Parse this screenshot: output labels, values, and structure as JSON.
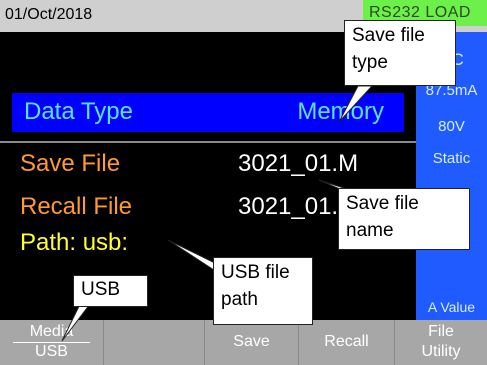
{
  "status_bar": {
    "date": "01/Oct/2018",
    "mode": "RS232 LOAD"
  },
  "data_type": {
    "label": "Data Type",
    "value": "Memory"
  },
  "save_file": {
    "label": "Save File",
    "value": "3021_01.M"
  },
  "recall_file": {
    "label": "Recall File",
    "value": "3021_01.M"
  },
  "path": {
    "label": "Path: usb:"
  },
  "sidebar": {
    "items": [
      "CC",
      "87.5mA",
      "80V",
      "Static",
      "A Value"
    ]
  },
  "softkeys": {
    "media_top": "Media",
    "media_bottom": "USB",
    "save": "Save",
    "recall": "Recall",
    "file_utility_top": "File",
    "file_utility_bottom": "Utility"
  },
  "callouts": {
    "save_file_type_1": "Save file",
    "save_file_type_2": "type",
    "save_file_name_1": "Save file",
    "save_file_name_2": "name",
    "usb_file_path_1": "USB file",
    "usb_file_path_2": "path",
    "usb": "USB"
  },
  "colors": {
    "status_bar": "#cfcfcf",
    "status_box": "#6ef04a",
    "data_type_bar": "#0000ff",
    "accent_cyan": "#5de1ff",
    "label_orange": "#ff9a2e",
    "label_yellow": "#ffff2b",
    "sidebar": "#1f5bff",
    "softkey_bg": "#a7a7a7"
  }
}
